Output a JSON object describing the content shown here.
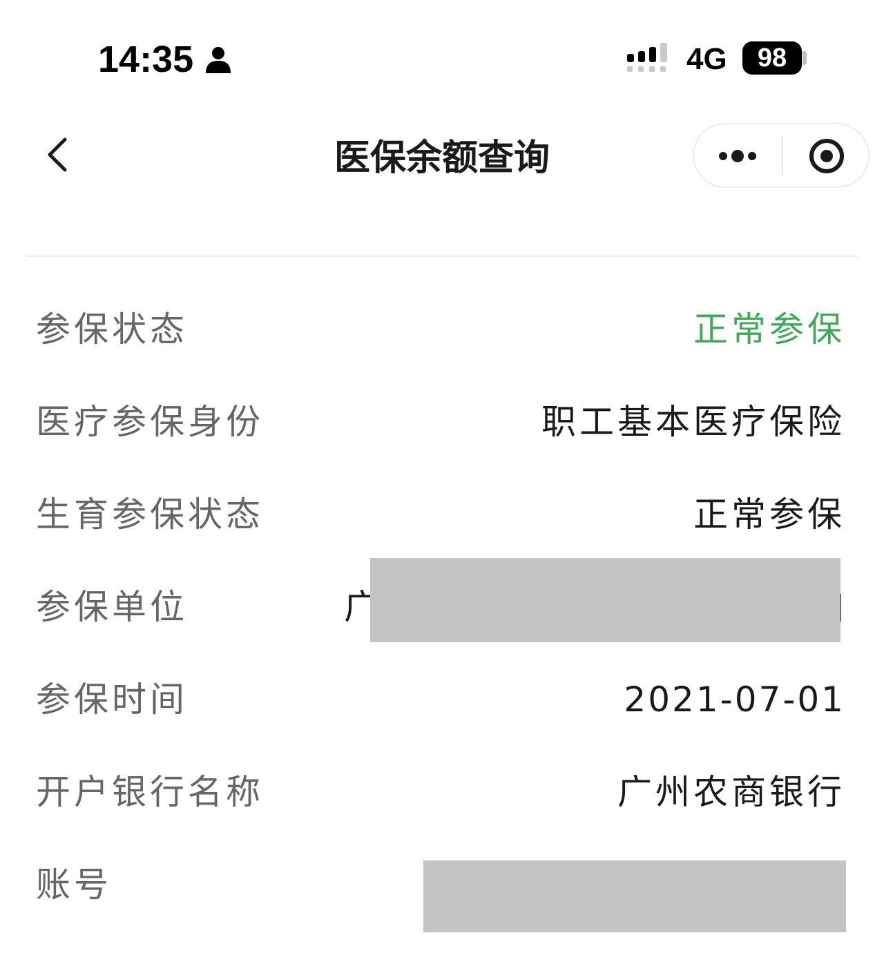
{
  "status_bar": {
    "time": "14:35",
    "network": "4G",
    "battery": "98",
    "icons": [
      "person-icon",
      "signal-icon"
    ]
  },
  "nav": {
    "title": "医保余额查询",
    "icons": [
      "back-chevron-icon",
      "more-dots-icon",
      "close-target-icon"
    ]
  },
  "rows": [
    {
      "label": "参保状态",
      "value": "正常参保"
    },
    {
      "label": "医疗参保身份",
      "value": "职工基本医疗保险"
    },
    {
      "label": "生育参保状态",
      "value": "正常参保"
    },
    {
      "label": "参保单位",
      "value": "广"
    },
    {
      "label": "参保时间",
      "value": "2021-07-01"
    },
    {
      "label": "开户银行名称",
      "value": "广州农商银行"
    },
    {
      "label": "账号",
      "value": ""
    }
  ],
  "colors": {
    "status_ok": "#3fa85b",
    "label": "#666666",
    "value": "#1a1a1a",
    "redaction": "#c4c4c4"
  }
}
